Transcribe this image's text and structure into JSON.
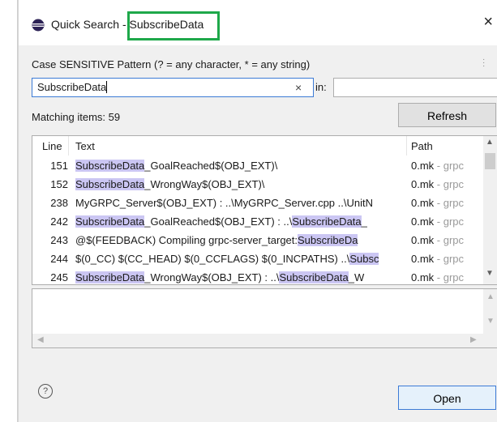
{
  "window": {
    "app_title": "Quick Search",
    "title_separator": "-",
    "query_title": "SubscribeData",
    "close_glyph": "×",
    "icons": {
      "app": "eclipse-logo-icon",
      "close": "close-icon"
    }
  },
  "search": {
    "pattern_label": "Case SENSITIVE Pattern (? = any character, * = any string)",
    "value": "SubscribeData",
    "clear_glyph": "×",
    "in_label": "in:",
    "in_value": "",
    "menu_icon": "vertical-dots-icon"
  },
  "results": {
    "match_label": "Matching items: 59",
    "refresh_label": "Refresh",
    "columns": {
      "line": "Line",
      "text": "Text",
      "path": "Path"
    },
    "highlight_color": "#cbc6f3",
    "rows": [
      {
        "line": "151",
        "segments": [
          {
            "t": "SubscribeData",
            "hl": true
          },
          {
            "t": "_GoalReached$(OBJ_EXT)\\",
            "hl": false
          }
        ],
        "path_main": "0.mk",
        "path_rest": " - grpc"
      },
      {
        "line": "152",
        "segments": [
          {
            "t": "SubscribeData",
            "hl": true
          },
          {
            "t": "_WrongWay$(OBJ_EXT)\\",
            "hl": false
          }
        ],
        "path_main": "0.mk",
        "path_rest": " - grpc"
      },
      {
        "line": "238",
        "segments": [
          {
            "t": "MyGRPC_Server$(OBJ_EXT) : ..\\MyGRPC_Server.cpp ..\\UnitN",
            "hl": false
          }
        ],
        "path_main": "0.mk",
        "path_rest": " - grpc"
      },
      {
        "line": "242",
        "segments": [
          {
            "t": "SubscribeData",
            "hl": true
          },
          {
            "t": "_GoalReached$(OBJ_EXT) : ..\\",
            "hl": false
          },
          {
            "t": "SubscribeData",
            "hl": true
          },
          {
            "t": "_",
            "hl": false
          }
        ],
        "path_main": "0.mk",
        "path_rest": " - grpc"
      },
      {
        "line": "243",
        "segments": [
          {
            "t": "@$(FEEDBACK) Compiling grpc-server_target:",
            "hl": false
          },
          {
            "t": "SubscribeDa",
            "hl": true
          }
        ],
        "path_main": "0.mk",
        "path_rest": " - grpc"
      },
      {
        "line": "244",
        "segments": [
          {
            "t": "$(0_CC) $(CC_HEAD) $(0_CCFLAGS) $(0_INCPATHS) ..\\",
            "hl": false
          },
          {
            "t": "Subsc",
            "hl": true
          }
        ],
        "path_main": "0.mk",
        "path_rest": " - grpc"
      },
      {
        "line": "245",
        "segments": [
          {
            "t": "SubscribeData",
            "hl": true
          },
          {
            "t": "_WrongWay$(OBJ_EXT) : ..\\",
            "hl": false
          },
          {
            "t": "SubscribeData",
            "hl": true
          },
          {
            "t": "_W",
            "hl": false
          }
        ],
        "path_main": "0.mk",
        "path_rest": " - grpc"
      }
    ]
  },
  "footer": {
    "help_glyph": "?",
    "help_icon": "help-icon",
    "open_label": "Open"
  },
  "accents": {
    "title_highlight_border": "#1ea84a",
    "focus_blue": "#3c7bd6"
  }
}
